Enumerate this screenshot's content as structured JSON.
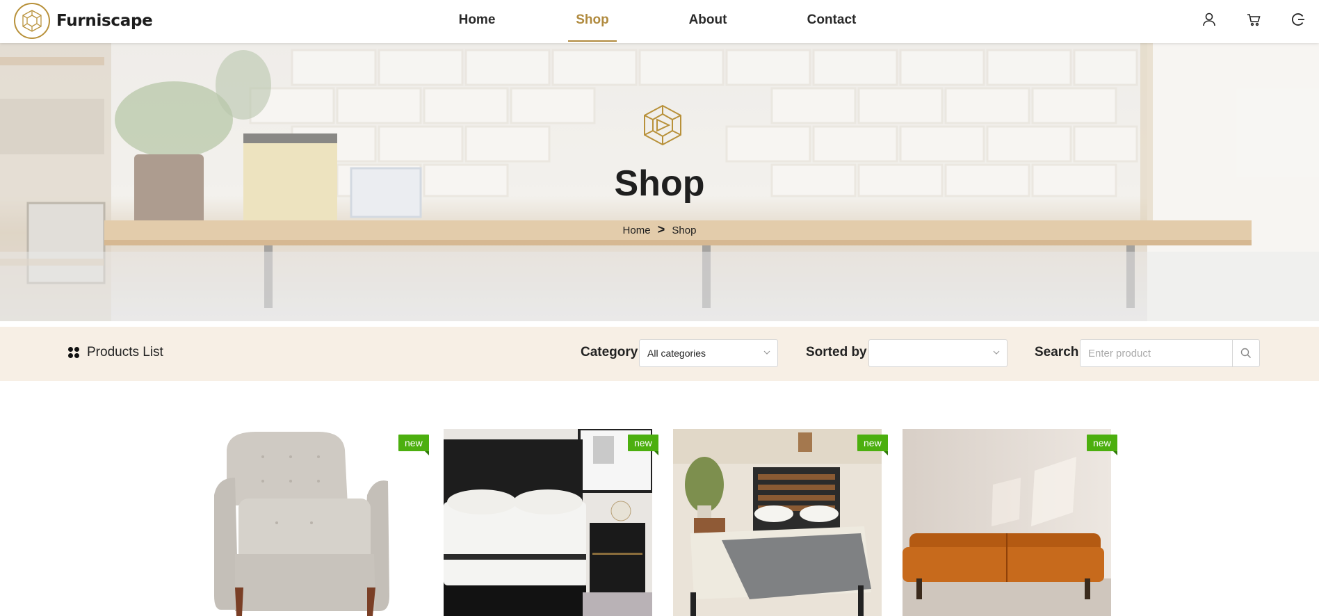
{
  "brand": {
    "name": "Furniscape",
    "logo_icon": "dodecahedron-logo-icon"
  },
  "nav": {
    "items": [
      {
        "label": "Home",
        "active": false
      },
      {
        "label": "Shop",
        "active": true
      },
      {
        "label": "About",
        "active": false
      },
      {
        "label": "Contact",
        "active": false
      }
    ],
    "icons": [
      "user-icon",
      "cart-icon",
      "logout-icon"
    ]
  },
  "hero": {
    "title": "Shop",
    "breadcrumb": {
      "home": "Home",
      "separator": ">",
      "current": "Shop"
    }
  },
  "filters": {
    "products_list_label": "Products List",
    "category_label": "Category",
    "category_value": "All categories",
    "sorted_by_label": "Sorted by",
    "sorted_by_value": "",
    "search_label": "Search",
    "search_placeholder": "Enter product"
  },
  "products": [
    {
      "image": "grey armchair",
      "badge": "new"
    },
    {
      "image": "mattress on black bed",
      "badge": "new"
    },
    {
      "image": "wooden headboard bed",
      "badge": "new"
    },
    {
      "image": "orange leather sofa",
      "badge": "new"
    }
  ],
  "colors": {
    "accent": "#b08a3e",
    "badge": "#4caf0f",
    "filterbar_bg": "#f7efe5"
  }
}
